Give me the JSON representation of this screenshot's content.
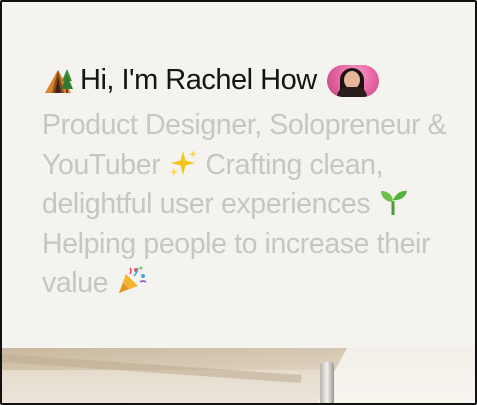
{
  "header": {
    "greeting": "Hi, I'm Rachel How",
    "leading_icon": "camping-tent-icon",
    "avatar_icon": "profile-avatar"
  },
  "bio": {
    "line1": "Product Designer, Solopreneur &",
    "line2_text": "YouTuber",
    "line2_tail": "Crafting clean,",
    "line3_text": "delightful user experiences",
    "line4": "Helping people to increase their",
    "line5_text": "value",
    "sparkles_icon": "sparkles-icon",
    "seedling_icon": "seedling-icon",
    "party_icon": "party-popper-icon"
  },
  "colors": {
    "heading": "#151515",
    "bio_text": "#c7c6c2",
    "background": "#f4f3ef"
  }
}
